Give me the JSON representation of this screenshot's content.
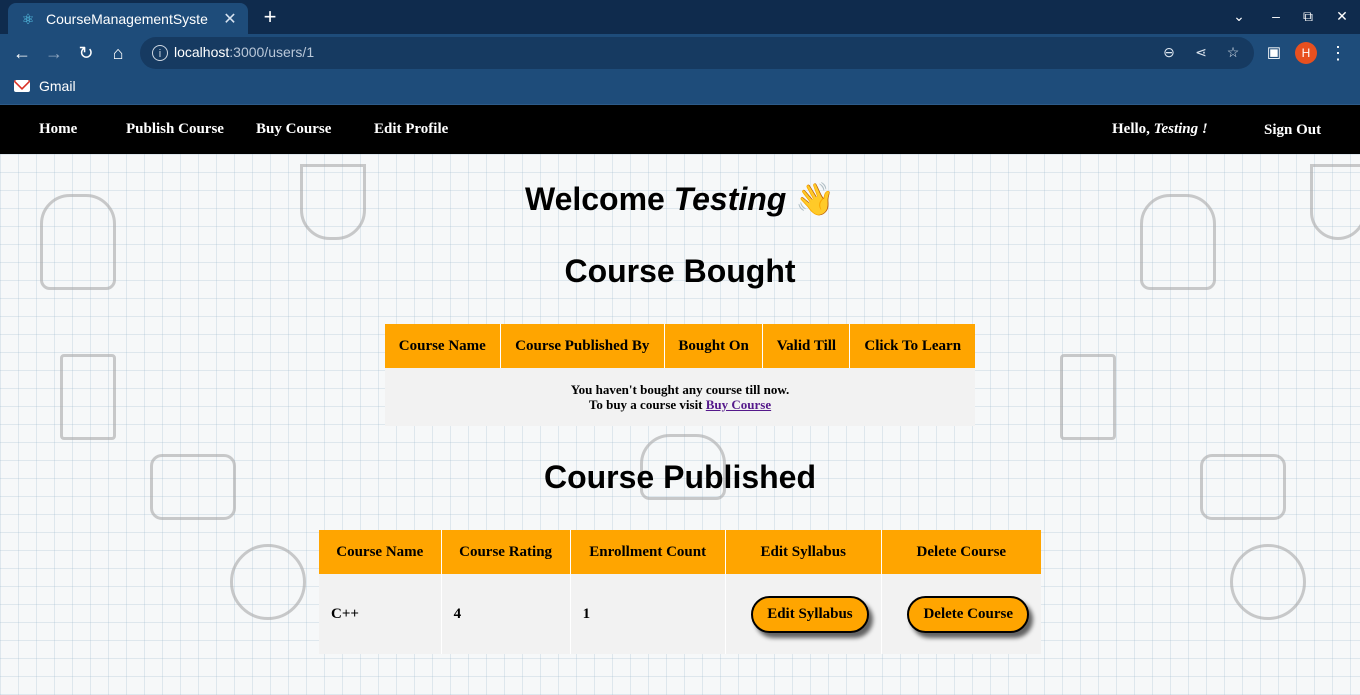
{
  "browser": {
    "tab_title": "CourseManagementSyste",
    "url_host": "localhost",
    "url_path": ":3000/users/1",
    "profile_initial": "H",
    "bookmark": "Gmail"
  },
  "nav": {
    "home": "Home",
    "publish": "Publish Course",
    "buy": "Buy Course",
    "edit_profile": "Edit Profile",
    "hello_prefix": "Hello,",
    "username": "Testing",
    "hello_suffix": "!",
    "signout": "Sign Out"
  },
  "welcome": {
    "prefix": "Welcome",
    "name": "Testing",
    "emoji": "👋"
  },
  "bought": {
    "heading": "Course Bought",
    "columns": [
      "Course Name",
      "Course Published By",
      "Bought On",
      "Valid Till",
      "Click To Learn"
    ],
    "empty_line1": "You haven't bought any course till now.",
    "empty_line2_prefix": "To buy a course visit",
    "empty_link": "Buy Course"
  },
  "published": {
    "heading": "Course Published",
    "columns": [
      "Course Name",
      "Course Rating",
      "Enrollment Count",
      "Edit Syllabus",
      "Delete Course"
    ],
    "rows": [
      {
        "name": "C++",
        "rating": "4",
        "enrollment": "1",
        "edit_label": "Edit Syllabus",
        "delete_label": "Delete Course"
      }
    ]
  }
}
